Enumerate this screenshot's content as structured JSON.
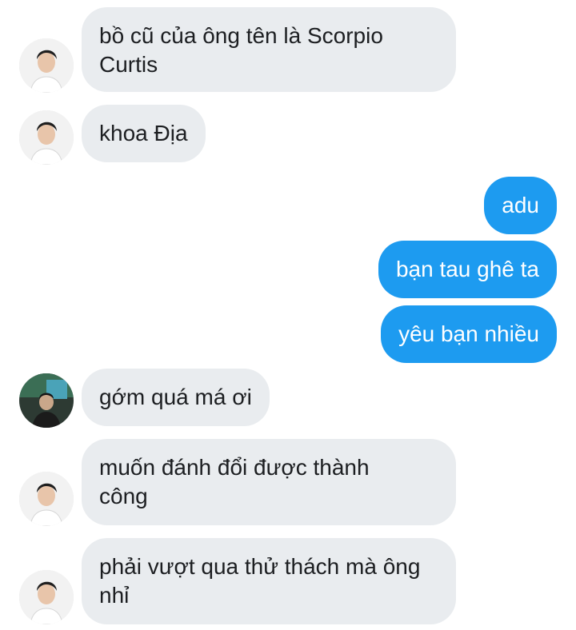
{
  "messages": [
    {
      "text": "bồ cũ của ông tên là Scorpio\nCurtis"
    },
    {
      "text": "khoa Địa"
    },
    {
      "text": "adu"
    },
    {
      "text": "bạn tau ghê ta"
    },
    {
      "text": "yêu bạn nhiều"
    },
    {
      "text": "gớm quá má ơi"
    },
    {
      "text": "muốn đánh đổi được thành\ncông"
    },
    {
      "text": "phải vượt qua thử thách mà ông\nnhỉ"
    }
  ],
  "colors": {
    "incoming_bubble": "#e9ecef",
    "outgoing_bubble": "#1d9bf0"
  },
  "icons": {
    "avatar_a": "person-portrait-avatar",
    "avatar_b": "person-outdoor-avatar"
  }
}
